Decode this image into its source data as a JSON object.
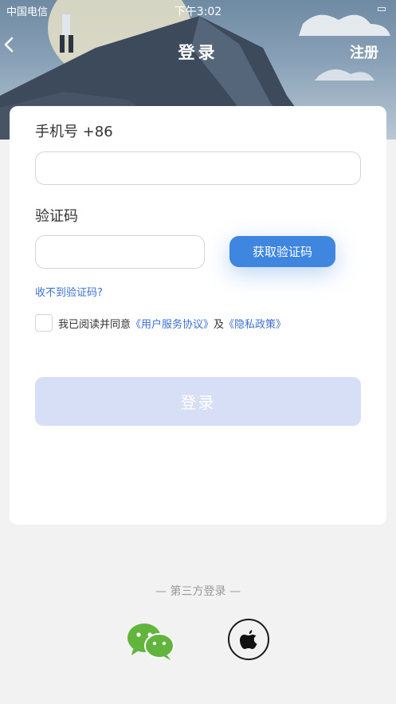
{
  "status": {
    "carrier": "中国电信",
    "time": "下午3:02"
  },
  "nav": {
    "title": "登录",
    "register": "注册"
  },
  "form": {
    "phone_label": "手机号 +86",
    "phone_value": "",
    "code_label": "验证码",
    "code_value": "",
    "get_code": "获取验证码",
    "no_code": "收不到验证码?",
    "agree_prefix": "我已阅读并同意",
    "terms": "《用户服务协议》",
    "and": "及",
    "privacy": "《隐私政策》",
    "login": "登录"
  },
  "third_party": {
    "label": "— 第三方登录 —"
  },
  "colors": {
    "accent": "#3e86e0",
    "link": "#3d6fd1",
    "login_disabled": "#d6dff6",
    "wechat": "#62b53c"
  }
}
